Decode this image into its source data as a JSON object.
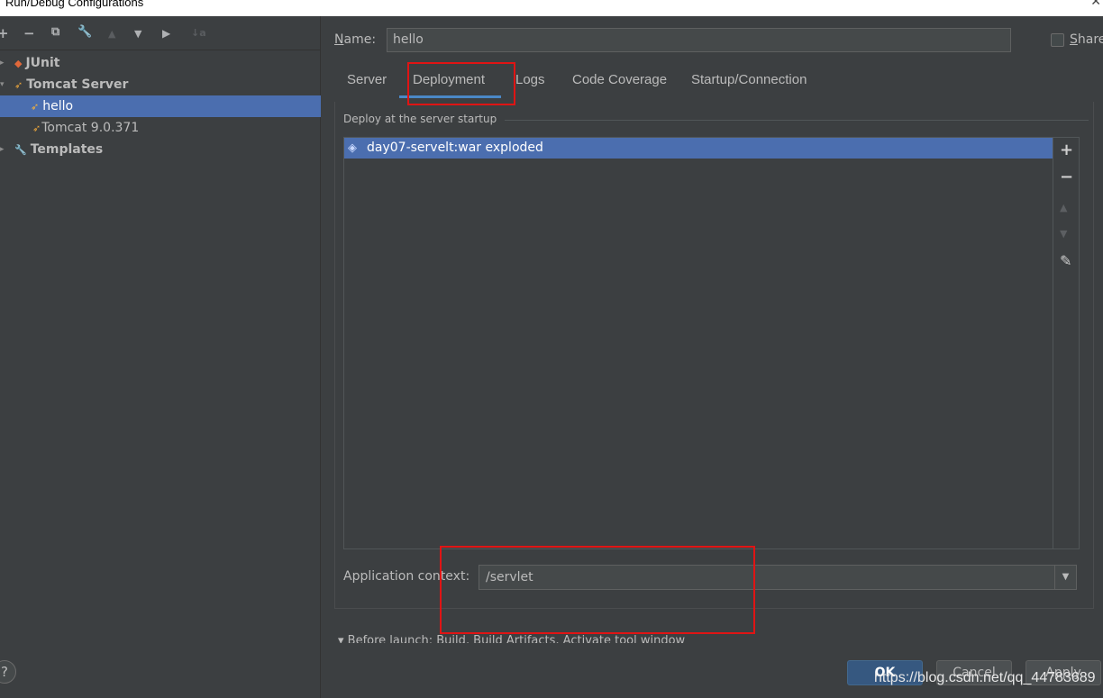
{
  "window": {
    "title": "Run/Debug Configurations",
    "close_glyph": "✕"
  },
  "toolbar": {
    "add": "+",
    "remove": "−",
    "copy": "⧉",
    "wrench": "🔧",
    "up": "▲",
    "down": "▼",
    "folder": "▶",
    "sort": "↓a"
  },
  "tree": {
    "junit": "JUnit",
    "tomcat_server": "Tomcat Server",
    "hello": "hello",
    "tomcat_template": "Tomcat 9.0.371",
    "templates": "Templates"
  },
  "form": {
    "name_label_first": "N",
    "name_label_rest": "ame:",
    "name_value": "hello",
    "share_first": "S",
    "share_rest": "hare"
  },
  "tabs": [
    "Server",
    "Deployment",
    "Logs",
    "Code Coverage",
    "Startup/Connection"
  ],
  "deployment": {
    "group_title": "Deploy at the server startup",
    "artifact": "day07-servelt:war exploded",
    "tools": {
      "add": "+",
      "remove": "−",
      "up": "▲",
      "down": "▼",
      "edit": "✎"
    }
  },
  "context": {
    "label": "Application context:",
    "value": "/servlet",
    "dropdown": "▼"
  },
  "before_launch": "▾  Before launch: Build, Build Artifacts, Activate tool window",
  "footer": {
    "help": "?",
    "ok": "OK",
    "cancel": "Cancel",
    "apply": "Apply",
    "watermark": "https://blog.csdn.net/qq_44783689"
  },
  "colors": {
    "selection": "#4b6eaf",
    "tab_underline": "#4a88c7",
    "highlight_box": "#e01414"
  }
}
